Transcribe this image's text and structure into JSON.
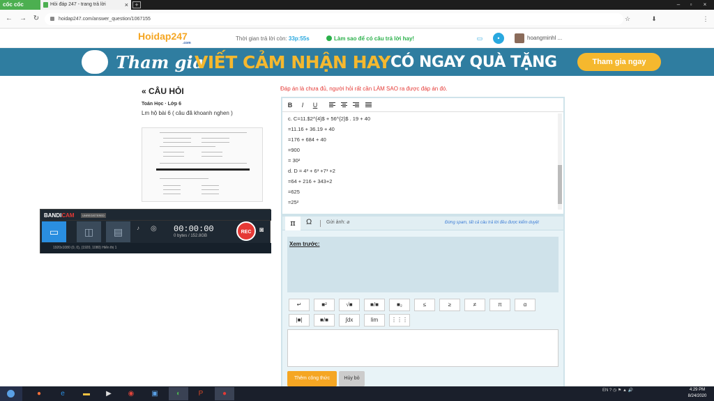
{
  "browser": {
    "brand": "cốc cốc",
    "tab_title": "Hỏi đáp 247 - trang trả lời",
    "tab_close": "×",
    "new_tab": "+",
    "url": "hoidap247.com/answer_question/1067155",
    "win_controls": [
      "–",
      "▫",
      "×"
    ],
    "nav": [
      "←",
      "→",
      "↻"
    ],
    "ext_icons": [
      "☆",
      "⬇",
      "⋮"
    ]
  },
  "site": {
    "logo": "Hoidap247",
    "logo_accent": "H",
    "logo_sub": ".com",
    "timer_label": "Thời gian trả lời còn:",
    "timer_value": "33p:55s",
    "howto": "Làm sao để có câu trả lời hay!",
    "username": "hoangminhl ..."
  },
  "banner": {
    "part1": "Tham gia",
    "part2": "VIẾT CẢM NHẬN HAY",
    "part3": "CÓ NGAY QUÀ TẶNG",
    "button": "Tham gia ngay"
  },
  "question": {
    "heading": "« CÂU HỎI",
    "subject": "Toán Học · Lớp 6",
    "text": "Lm hộ bài 6 ( câu đã khoanh nghen )"
  },
  "bandicam": {
    "name_a": "BANDI",
    "name_b": "CAM",
    "unregistered": "UNREGISTERED",
    "time": "00:00:00",
    "size": "0 bytes / 152.8GB",
    "rec": "REC",
    "status": "1920x1080    (0, 0), (1920, 1080)    Hiển thị 1"
  },
  "answer": {
    "notice": "Đáp án là chưa đủ, người hỏi rất cần LÀM SAO ra được đáp án đó.",
    "toolbar": [
      "B",
      "I",
      "U"
    ],
    "lines": [
      "c. C=11.$2^{4}$ + 56^{2}$ . 19 + 40",
      "=11.16 + 36.19 + 40",
      "=176 + 684 + 40",
      "=900",
      "= 30²",
      "d. D = 4³ + 6³ +7³ +2",
      "=64 + 216 + 343+2",
      "=625",
      "=25²"
    ]
  },
  "math": {
    "tab_pi": "π",
    "tab_omega": "Ω",
    "upload": "Gửi ảnh:",
    "spam_note": "Đừng spam, tất cả câu trả lời đều được kiểm duyệt",
    "preview_label": "Xem trước:",
    "row1": [
      "↵",
      "■²",
      "√■",
      "■/■",
      "■₂",
      "≤",
      "≥",
      "≠",
      "π",
      "α"
    ],
    "row2": [
      "|■|",
      "■/■",
      "∫dx",
      "lim",
      "⋮⋮⋮"
    ],
    "add_button": "Thêm công thức",
    "cancel_button": "Hủy bỏ"
  },
  "taskbar": {
    "tray": "EN  ?  ◷  ⚑  ▲  🔊",
    "time": "4:29 PM",
    "date": "8/24/2020"
  }
}
